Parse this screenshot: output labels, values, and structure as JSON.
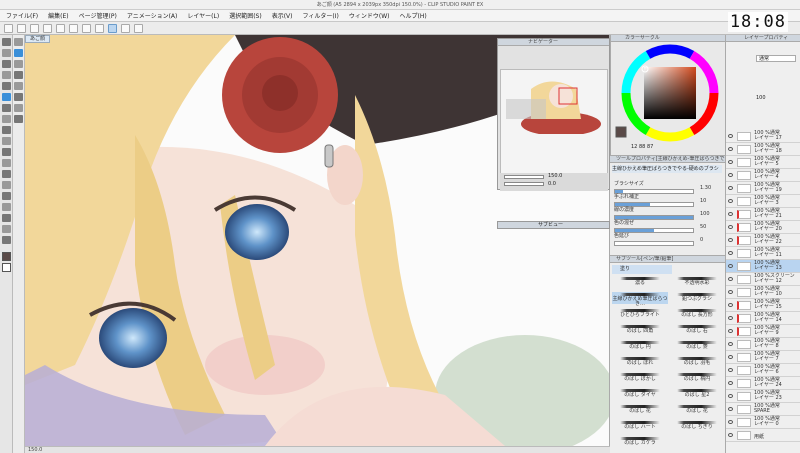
{
  "window": {
    "title": "あご顔 (A5 2894 x 2039px 350dpi 150.0%) - CLIP STUDIO PAINT EX"
  },
  "clock": "18:08",
  "menu": [
    "ファイル(F)",
    "編集(E)",
    "ページ管理(P)",
    "アニメーション(A)",
    "レイヤー(L)",
    "選択範囲(S)",
    "表示(V)",
    "フィルター(I)",
    "ウィンドウ(W)",
    "ヘルプ(H)"
  ],
  "canvas": {
    "tab_label": "あご顔",
    "status_zoom": "150.0"
  },
  "navigator": {
    "title": "ナビゲーター",
    "zoom": "150.0",
    "angle": "0.0"
  },
  "subview": {
    "title": "サブビュー"
  },
  "color_panel": {
    "title": "カラーサークル",
    "h": "12",
    "s": "88",
    "v": "87"
  },
  "tool_property": {
    "title": "ツールプロパティ[主線ひかえめ-筆圧ばらつきでやる…ガタブラシ]",
    "brush_name": "主線ひかえめ筆圧ばらつきでやる-硬めのブラシ",
    "rows": [
      {
        "label": "ブラシサイズ",
        "value": "1.30",
        "fill": 0.1
      },
      {
        "label": "手ぶれ補正",
        "value": "10",
        "fill": 0.45
      },
      {
        "label": "線の濃度",
        "value": "100",
        "fill": 1.0
      },
      {
        "label": "色の混ぜ",
        "value": "50",
        "fill": 0.5
      },
      {
        "label": "色延び",
        "value": "0",
        "fill": 0.0
      }
    ]
  },
  "subtool": {
    "title": "サブツール[ペン/筆/鉛筆]",
    "group_label": "塗り",
    "brushes": [
      {
        "name": "濃る",
        "selected": false
      },
      {
        "name": "不透明水彩",
        "selected": false
      },
      {
        "name": "主線ひかえめ筆圧ばらつき…",
        "selected": true
      },
      {
        "name": "鉛つぶグラシ",
        "selected": false
      },
      {
        "name": "ひとひらフライト",
        "selected": false
      },
      {
        "name": "のばし 長方形",
        "selected": false
      },
      {
        "name": "のばし 四角",
        "selected": false
      },
      {
        "name": "のばし 右",
        "selected": false
      },
      {
        "name": "のばし 円",
        "selected": false
      },
      {
        "name": "のばし 菱",
        "selected": false
      },
      {
        "name": "のばし ぼれ",
        "selected": false
      },
      {
        "name": "のばし 羽毛",
        "selected": false
      },
      {
        "name": "のばし ぼかし",
        "selected": false
      },
      {
        "name": "のばし 楕円",
        "selected": false
      },
      {
        "name": "のばし ダイヤ",
        "selected": false
      },
      {
        "name": "のばし 星2",
        "selected": false
      },
      {
        "name": "のばし 花",
        "selected": false
      },
      {
        "name": "のばし 花",
        "selected": false
      },
      {
        "name": "のばし ハート",
        "selected": false
      },
      {
        "name": "のばし ちぎり",
        "selected": false
      },
      {
        "name": "のばし カケラ",
        "selected": false
      }
    ]
  },
  "layers": {
    "title": "レイヤープロパティ",
    "blend": "通常",
    "opacity": "100",
    "items": [
      {
        "name": "レイヤー 17",
        "mode": "100 %通常",
        "selected": false,
        "red": false
      },
      {
        "name": "レイヤー 18",
        "mode": "100 %通常",
        "selected": false,
        "red": false
      },
      {
        "name": "レイヤー 5",
        "mode": "100 %通常",
        "selected": false,
        "red": false
      },
      {
        "name": "レイヤー 4",
        "mode": "100 %通常",
        "selected": false,
        "red": false
      },
      {
        "name": "レイヤー 19",
        "mode": "100 %通常",
        "selected": false,
        "red": false
      },
      {
        "name": "レイヤー 3",
        "mode": "100 %通常",
        "selected": false,
        "red": false
      },
      {
        "name": "レイヤー 21",
        "mode": "100 %通常",
        "selected": false,
        "red": true
      },
      {
        "name": "レイヤー 20",
        "mode": "100 %通常",
        "selected": false,
        "red": true
      },
      {
        "name": "レイヤー 22",
        "mode": "100 %通常",
        "selected": false,
        "red": true
      },
      {
        "name": "レイヤー 11",
        "mode": "100 %通常",
        "selected": false,
        "red": false
      },
      {
        "name": "レイヤー 13",
        "mode": "100 %通常",
        "selected": true,
        "red": false
      },
      {
        "name": "レイヤー 12",
        "mode": "100 %スクリーン",
        "selected": false,
        "red": false
      },
      {
        "name": "レイヤー 10",
        "mode": "100 %通常",
        "selected": false,
        "red": false
      },
      {
        "name": "レイヤー 15",
        "mode": "100 %通常",
        "selected": false,
        "red": true
      },
      {
        "name": "レイヤー 14",
        "mode": "100 %通常",
        "selected": false,
        "red": true
      },
      {
        "name": "レイヤー 9",
        "mode": "100 %通常",
        "selected": false,
        "red": true
      },
      {
        "name": "レイヤー 8",
        "mode": "100 %通常",
        "selected": false,
        "red": false
      },
      {
        "name": "レイヤー 7",
        "mode": "100 %通常",
        "selected": false,
        "red": false
      },
      {
        "name": "レイヤー 6",
        "mode": "100 %通常",
        "selected": false,
        "red": false
      },
      {
        "name": "レイヤー 24",
        "mode": "100 %通常",
        "selected": false,
        "red": false
      },
      {
        "name": "レイヤー 23",
        "mode": "100 %通常",
        "selected": false,
        "red": false
      },
      {
        "name": "SPARE",
        "mode": "100 %通常",
        "selected": false,
        "red": false
      },
      {
        "name": "レイヤー 0",
        "mode": "100 %通常",
        "selected": false,
        "red": false
      },
      {
        "name": "用紙",
        "mode": "",
        "selected": false,
        "red": false
      }
    ]
  },
  "colors": {
    "accent": "#3a8fd9",
    "selected_row": "#b9d4f0",
    "hair": "#f2d79a",
    "rose": "#b8453c"
  }
}
